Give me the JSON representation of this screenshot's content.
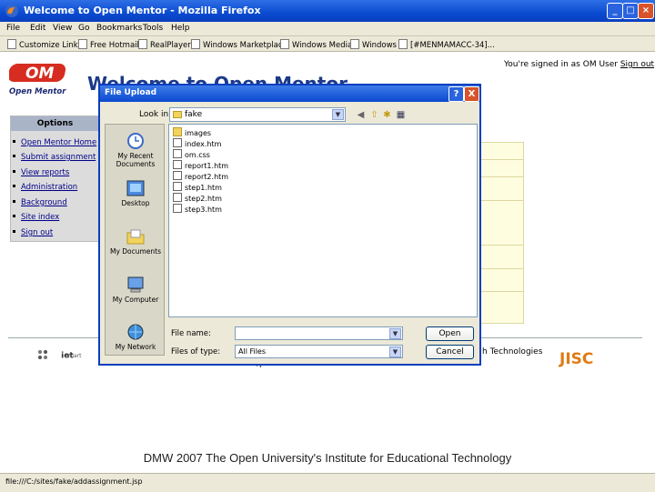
{
  "window": {
    "title": "Welcome to Open Mentor - Mozilla Firefox"
  },
  "menu": [
    "File",
    "Edit",
    "View",
    "Go",
    "Bookmarks",
    "Tools",
    "Help"
  ],
  "links_toolbar": [
    "Customize Links",
    "Free Hotmail",
    "RealPlayer",
    "Windows Marketplace",
    "Windows Media",
    "Windows",
    "[#MENMAMACC-34]..."
  ],
  "page": {
    "logo_text": "Open Mentor",
    "logo_mark": "OM",
    "welcome": "Welcome to Open Mentor",
    "signed_in_text": "You're signed in as OM User",
    "sign_out": "Sign out",
    "options": {
      "header": "Options",
      "items": [
        "Open Mentor Home",
        "Submit assignment",
        "View reports",
        "Administration",
        "Background",
        "Site index",
        "Sign out"
      ]
    },
    "footer_tech": "h Technologies",
    "partner_iet": "iet",
    "partner_smart": "smart",
    "partner_jisc": "JISC",
    "partner_fragment": "/p",
    "caption": "DMW 2007 The Open University's Institute for Educational Technology"
  },
  "status_bar": "file:///C:/sites/fake/addassignment.jsp",
  "dialog": {
    "title": "File Upload",
    "help_btn": "?",
    "close_btn": "X",
    "look_in_label": "Look in:",
    "look_in_value": "fake",
    "places": [
      "My Recent Documents",
      "Desktop",
      "My Documents",
      "My Computer",
      "My Network"
    ],
    "files": [
      {
        "name": "images",
        "type": "folder"
      },
      {
        "name": "index.htm",
        "type": "file"
      },
      {
        "name": "om.css",
        "type": "file"
      },
      {
        "name": "report1.htm",
        "type": "file"
      },
      {
        "name": "report2.htm",
        "type": "file"
      },
      {
        "name": "step1.htm",
        "type": "file"
      },
      {
        "name": "step2.htm",
        "type": "file"
      },
      {
        "name": "step3.htm",
        "type": "file"
      }
    ],
    "file_name_label": "File name:",
    "file_name_value": "",
    "files_of_type_label": "Files of type:",
    "files_of_type_value": "All Files",
    "open_btn": "Open",
    "cancel_btn": "Cancel"
  },
  "colors": {
    "titlebar": "#0a4bd0",
    "link": "#00008b",
    "jisc": "#e07a14",
    "logo_red": "#d62d20"
  }
}
